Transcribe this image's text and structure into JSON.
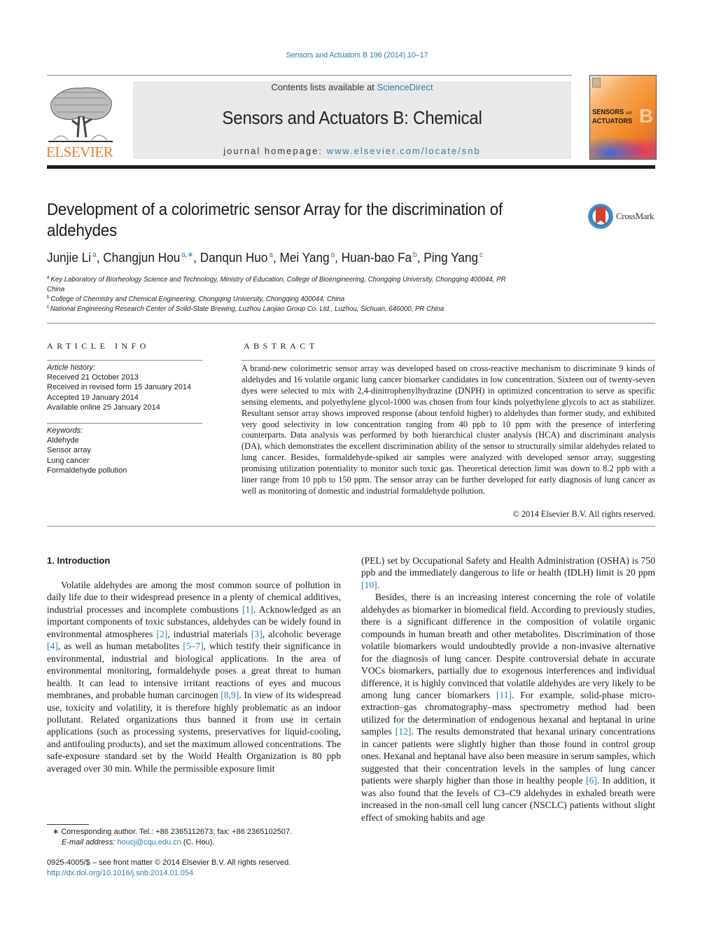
{
  "header": {
    "citation": "Sensors and Actuators B 196 (2014) 10–17",
    "contents_prefix": "Contents lists available at ",
    "contents_link": "ScienceDirect",
    "journal_title": "Sensors and Actuators B: Chemical",
    "homepage_prefix": "journal homepage: ",
    "homepage_link": "www.elsevier.com/locate/snb",
    "publisher_logo_text": "ELSEVIER",
    "cover_title_line1": "SENSORS",
    "cover_title_and": "and",
    "cover_title_line2": "ACTUATORS",
    "cover_letter": "B",
    "crossmark_text": "CrossMark",
    "link_color": "#2a7fad",
    "elsevier_orange": "#f07c21"
  },
  "article": {
    "title": "Development of a colorimetric sensor Array for the discrimination of aldehydes",
    "authors": [
      {
        "name": "Junjie Li",
        "sup": "a",
        "sep": ", "
      },
      {
        "name": "Changjun Hou",
        "sup": "a,∗",
        "sep": ", "
      },
      {
        "name": "Danqun Huo",
        "sup": "a",
        "sep": ", "
      },
      {
        "name": "Mei Yang",
        "sup": "a",
        "sep": ", "
      },
      {
        "name": "Huan-bao Fa",
        "sup": "b",
        "sep": ", "
      },
      {
        "name": "Ping Yang",
        "sup": "c",
        "sep": ""
      }
    ],
    "affiliations": [
      {
        "key": "a",
        "text": "Key Laboratory of Biorheology Science and Technology, Ministry of Education, College of Bioengineering, Chongqing University, Chongqing 400044, PR China"
      },
      {
        "key": "b",
        "text": "College of Chemistry and Chemical Engineering, Chongqing University, Chongqing 400044, China"
      },
      {
        "key": "c",
        "text": "National Engineering Research Center of Solid-State Brewing, Luzhou Laojiao Group Co. Ltd., Luzhou, Sichuan, 646000, PR China"
      }
    ]
  },
  "article_info": {
    "heading": "ARTICLE INFO",
    "history_label": "Article history:",
    "history": [
      "Received 21 October 2013",
      "Received in revised form 15 January 2014",
      "Accepted 19 January 2014",
      "Available online 25 January 2014"
    ],
    "keywords_label": "Keywords:",
    "keywords": [
      "Aldehyde",
      "Sensor array",
      "Lung cancer",
      "Formaldehyde pollution"
    ]
  },
  "abstract": {
    "heading": "ABSTRACT",
    "text": "A brand-new colorimetric sensor array was developed based on cross-reactive mechanism to discrimi­nate 9 kinds of aldehydes and 16 volatile organic lung cancer biomarker candidates in low concentration. Sixteen out of twenty-seven dyes were selected to mix with 2,4-dinitrophenylhydrazine (DNPH) in opti­mized concentration to serve as specific sensing elements, and polyethylene glycol-1000 was chosen from four kinds polyethylene glycols to act as stabilizer. Resultant sensor array shows improved response (about tenfold higher) to aldehydes than former study, and exhibited very good selectivity in low con­centration ranging from 40 ppb to 10 ppm with the presence of interfering counterparts. Data analysis was performed by both hierarchical cluster analysis (HCA) and discriminant analysis (DA), which demon­strates the excellent discrimination ability of the sensor to structurally similar aldehydes related to lung cancer. Besides, formaldehyde-spiked air samples were analyzed with developed sensor array, suggest­ing promising utilization potentiality to monitor such toxic gas. Theoretical detection limit was down to 8.2 ppb with a liner range from 10 ppb to 150 ppm. The sensor array can be further developed for early diagnosis of lung cancer as well as monitoring of domestic and industrial formaldehyde pollution.",
    "copyright": "© 2014 Elsevier B.V. All rights reserved."
  },
  "introduction": {
    "heading": "1.  Introduction",
    "left_column": [
      {
        "t": "Volatile aldehydes are among the most common source of pol­lution in daily life due to their widespread presence in a plenty of chemical additives, industrial processes and incomplete com­bustions "
      },
      {
        "ref": "[1]"
      },
      {
        "t": ". Acknowledged as an important components of toxic substances, aldehydes can be widely found in environmental atmo­spheres "
      },
      {
        "ref": "[2]"
      },
      {
        "t": ", industrial materials "
      },
      {
        "ref": "[3]"
      },
      {
        "t": ", alcoholic beverage "
      },
      {
        "ref": "[4]"
      },
      {
        "t": ", as well as human metabolites "
      },
      {
        "ref": "[5–7]"
      },
      {
        "t": ", which testify their significance in environmental, industrial and biological applications. In the area of environmental monitoring, formaldehyde poses a great threat to human health. It can lead to intensive irritant reactions of eyes and mucous membranes, and probable human carcinogen "
      },
      {
        "ref": "[8,9]"
      },
      {
        "t": ". In view of its widespread use, toxicity and volatility, it is therefore highly problematic as an indoor pollutant. Related orga­nizations thus banned it from use in certain applications (such as processing systems, preservatives for liquid-cooling, and antifoul­ing products), and set the maximum allowed concentrations. The safe-exposure standard set by the World Health Organization is 80 ppb averaged over 30 min. While the permissible exposure limit"
      }
    ],
    "right_p1": [
      {
        "t": "(PEL) set by Occupational Safety and Health Administration (OSHA) is 750 ppb and the immediately dangerous to life or health (IDLH) limit is 20 ppm "
      },
      {
        "ref": "[10]"
      },
      {
        "t": "."
      }
    ],
    "right_p2": [
      {
        "t": "Besides, there is an increasing interest concerning the role of volatile aldehydes as biomarker in biomedical field. According to previously studies, there is a significant difference in the compo­sition of volatile organic compounds in human breath and other metabolites. Discrimination of those volatile biomarkers would undoubtedly provide a non-invasive alternative for the diagno­sis of lung cancer. Despite controversial debate in accurate VOCs biomarkers, partially due to exogenous interferences and individ­ual difference, it is highly convinced that volatile aldehydes are very likely to be among lung cancer biomarkers "
      },
      {
        "ref": "[11]"
      },
      {
        "t": ". For example, solid-phase micro-extraction–gas chromatography–mass spectrometry method had been utilized for the determination of endogenous hexanal and heptanal in urine samples "
      },
      {
        "ref": "[12]"
      },
      {
        "t": ". The results demon­strated that hexanal urinary concentrations in cancer patients were slightly higher than those found in control group ones. Hexanal and heptanal have also been measure in serum samples, which sug­gested that their concentration levels in the samples of lung cancer patients were sharply higher than those in healthy people "
      },
      {
        "ref": "[6]"
      },
      {
        "t": ". In addition, it was also found that the levels of C3–C9 aldehydes in exhaled breath were increased in the non-small cell lung cancer (NSCLC) patients without slight effect of smoking habits and age"
      }
    ]
  },
  "footnotes": {
    "corresponding": "∗  Corresponding author. Tel.: +86 2365112673; fax: +86 2365102507.",
    "email_label": "E-mail address: ",
    "email": "houcj@cqu.edu.cn",
    "email_suffix": " (C. Hou).",
    "front_matter": "0925-4005/$ – see front matter © 2014 Elsevier B.V. All rights reserved.",
    "doi": "http://dx.doi.org/10.1016/j.snb.2014.01.054"
  }
}
